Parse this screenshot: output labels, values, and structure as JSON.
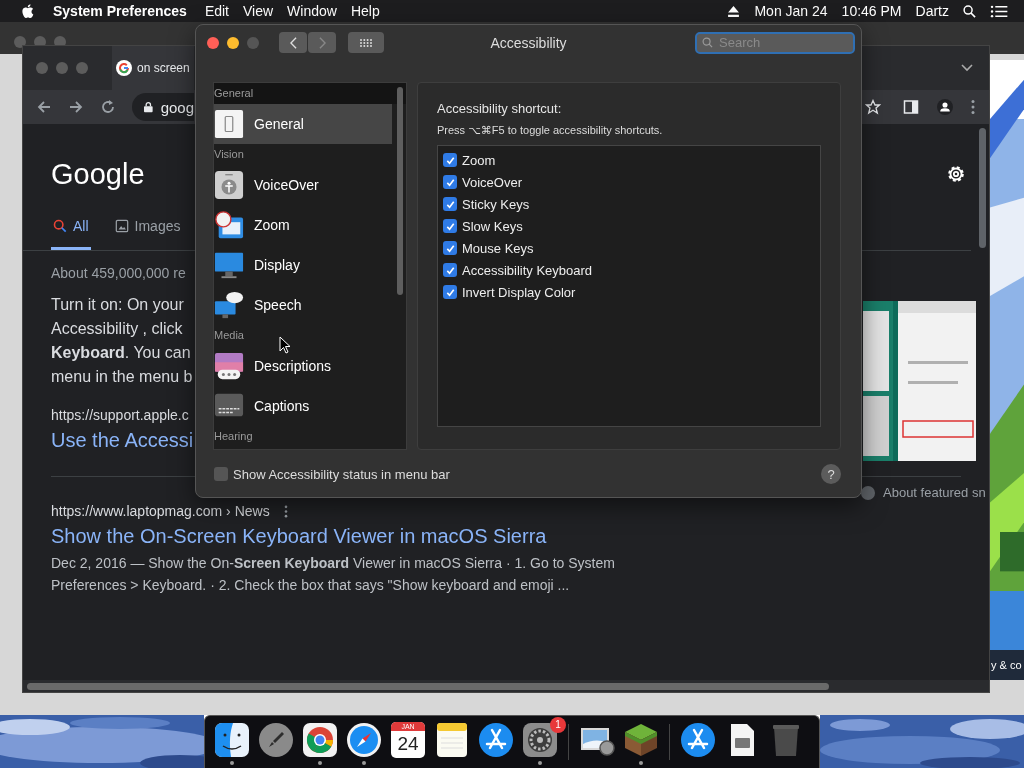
{
  "menu_bar": {
    "app": "System Preferences",
    "menus": [
      "Edit",
      "View",
      "Window",
      "Help"
    ],
    "date": "Mon Jan 24",
    "time": "10:46 PM",
    "user": "Dartz"
  },
  "browser": {
    "tab_title": "on screen",
    "url": "goog",
    "logo": "Google",
    "search_tabs": [
      {
        "label": "All",
        "selected": true
      },
      {
        "label": "Images",
        "selected": false
      }
    ],
    "result_count": "About 459,000,000 re",
    "snippet_lines": [
      "Turn it on: On your",
      "Accessibility , click",
      "**Keyboard**. You can",
      "menu in the menu b"
    ],
    "source_url": "https://support.apple.c",
    "source_title": "Use the Accessi",
    "featured_note": "About featured sn",
    "results": [
      {
        "url": "https://www.laptopmag.com › News",
        "title": "Show the On-Screen Keyboard Viewer in macOS Sierra",
        "snippet_lines": [
          "Dec 2, 2016 — Show the On-**Screen Keyboard** Viewer in macOS Sierra · 1. Go to System",
          "Preferences > Keyboard. · 2. Check the box that says \"Show keyboard and emoji ..."
        ]
      }
    ]
  },
  "side_window": {
    "caption": "y & co"
  },
  "prefs_window": {
    "title": "Accessibility",
    "search": {
      "placeholder": "Search"
    },
    "sidebar": [
      {
        "header": "General",
        "items": [
          {
            "label": "General",
            "selected": true
          }
        ]
      },
      {
        "header": "Vision",
        "items": [
          {
            "label": "VoiceOver",
            "selected": false
          },
          {
            "label": "Zoom",
            "selected": false
          },
          {
            "label": "Display",
            "selected": false
          },
          {
            "label": "Speech",
            "selected": false
          }
        ]
      },
      {
        "header": "Media",
        "items": [
          {
            "label": "Descriptions",
            "selected": false
          },
          {
            "label": "Captions",
            "selected": false
          }
        ]
      },
      {
        "header": "Hearing"
      }
    ],
    "shortcut_title": "Accessibility shortcut:",
    "shortcut_hint": "Press ⌥⌘F5 to toggle accessibility shortcuts.",
    "shortcuts": [
      {
        "label": "Zoom",
        "checked": true
      },
      {
        "label": "VoiceOver",
        "checked": true
      },
      {
        "label": "Sticky Keys",
        "checked": true
      },
      {
        "label": "Slow Keys",
        "checked": true
      },
      {
        "label": "Mouse Keys",
        "checked": true
      },
      {
        "label": "Accessibility Keyboard",
        "checked": true
      },
      {
        "label": "Invert Display Color",
        "checked": true
      }
    ],
    "status_option": {
      "label": "Show Accessibility status in menu bar",
      "checked": false
    },
    "help": "?"
  },
  "dock": {
    "calendar_month": "JAN",
    "calendar_day": "24",
    "badge": "1",
    "apps": [
      {
        "running": true
      },
      {
        "running": false
      },
      {
        "running": true
      },
      {
        "running": true
      },
      {
        "running": false
      },
      {
        "running": false
      },
      {
        "running": false
      },
      {
        "running": true
      },
      {
        "running": false
      },
      {
        "running": true
      },
      {
        "running": false
      },
      {
        "running": false
      },
      {
        "running": false
      }
    ]
  }
}
